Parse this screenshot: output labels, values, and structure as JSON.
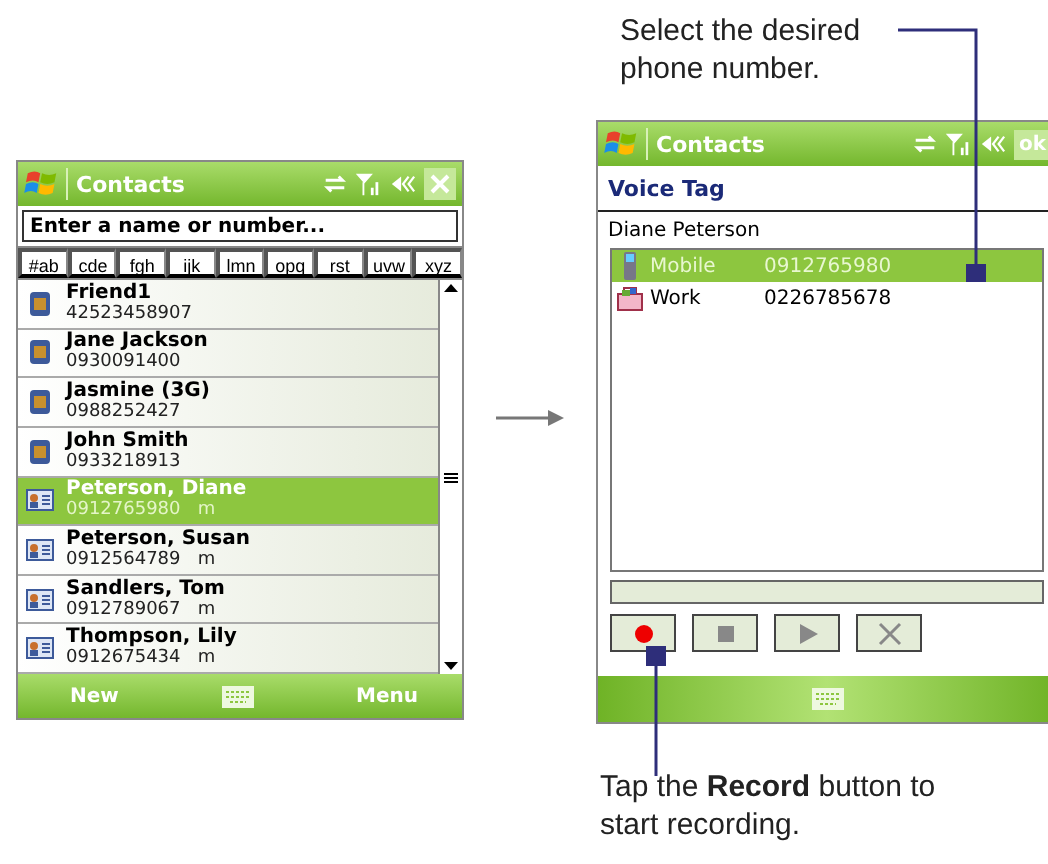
{
  "left_screen": {
    "title": "Contacts",
    "search": {
      "placeholder": "Enter a name or number..."
    },
    "letter_tabs": [
      {
        "label": "#ab",
        "selected": false
      },
      {
        "label": "cde",
        "selected": false
      },
      {
        "label": "fgh",
        "selected": false
      },
      {
        "label": "ijk",
        "selected": false
      },
      {
        "label": "lmn",
        "selected": false
      },
      {
        "label": "opq",
        "selected": false
      },
      {
        "label": "rst",
        "selected": false
      },
      {
        "label": "uvw",
        "selected": false
      },
      {
        "label": "xyz",
        "selected": false
      }
    ],
    "contacts": [
      {
        "name": "Friend1",
        "number": "42523458907",
        "kind": "sim",
        "selected": false
      },
      {
        "name": "Jane Jackson",
        "number": "0930091400",
        "kind": "sim",
        "selected": false
      },
      {
        "name": "Jasmine (3G)",
        "number": "0988252427",
        "kind": "sim",
        "selected": false
      },
      {
        "name": "John Smith",
        "number": "0933218913",
        "kind": "sim",
        "selected": false
      },
      {
        "name": "Peterson, Diane",
        "number": "0912765980",
        "suffix": "m",
        "kind": "card",
        "selected": true
      },
      {
        "name": "Peterson, Susan",
        "number": "0912564789",
        "suffix": "m",
        "kind": "card",
        "selected": false
      },
      {
        "name": "Sandlers, Tom",
        "number": "0912789067",
        "suffix": "m",
        "kind": "card",
        "selected": false
      },
      {
        "name": "Thompson, Lily",
        "number": "0912675434",
        "suffix": "m",
        "kind": "card",
        "selected": false
      }
    ],
    "softkeys": [
      "New",
      "Menu"
    ]
  },
  "right_screen": {
    "title": "Contacts",
    "ok": "ok",
    "header": "Voice Tag",
    "contact_name": "Diane Peterson",
    "numbers": [
      {
        "label": "Mobile",
        "number": "0912765980",
        "kind": "mobile",
        "selected": true
      },
      {
        "label": "Work",
        "number": "0226785678",
        "kind": "work",
        "selected": false
      }
    ],
    "progress": {
      "level": 0
    },
    "controls": [
      {
        "kind": "record"
      },
      {
        "kind": "stop"
      },
      {
        "kind": "play"
      },
      {
        "kind": "delete"
      }
    ]
  },
  "callouts": [
    "Select the desired phone number.",
    "Tap the **Record** button to start recording."
  ]
}
